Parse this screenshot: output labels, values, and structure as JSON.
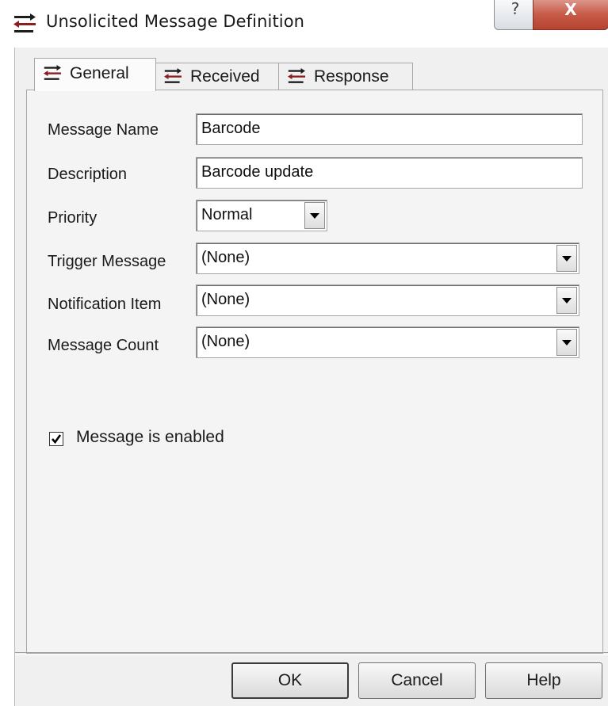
{
  "window": {
    "title": "Unsolicited Message Definition",
    "app_icon": "transfer-arrows-icon",
    "help_glyph": "?",
    "close_glyph": "X",
    "accent_close": "#c75a48"
  },
  "tabs": [
    {
      "label": "General",
      "icon": "transfer-arrows-icon",
      "active": true
    },
    {
      "label": "Received",
      "icon": "transfer-arrows-icon",
      "active": false
    },
    {
      "label": "Response",
      "icon": "transfer-arrows-icon",
      "active": false
    }
  ],
  "form": {
    "message_name": {
      "label": "Message Name",
      "value": "Barcode"
    },
    "description": {
      "label": "Description",
      "value": "Barcode update"
    },
    "priority": {
      "label": "Priority",
      "value": "Normal"
    },
    "trigger_message": {
      "label": "Trigger Message",
      "value": "(None)"
    },
    "notification_item": {
      "label": "Notification Item",
      "value": "(None)"
    },
    "message_count": {
      "label": "Message Count",
      "value": "(None)"
    },
    "enabled": {
      "label": "Message is enabled",
      "checked": true
    }
  },
  "buttons": {
    "ok": "OK",
    "cancel": "Cancel",
    "help": "Help"
  }
}
